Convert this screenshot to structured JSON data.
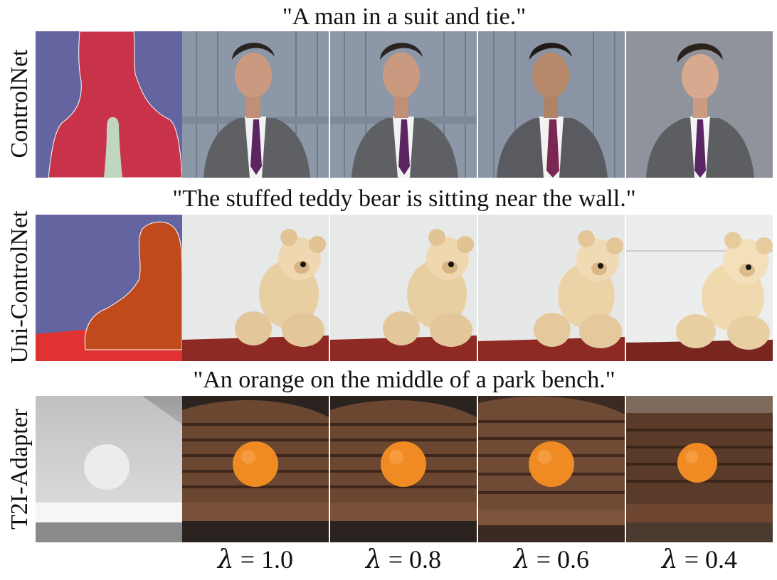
{
  "rows": [
    {
      "method": "ControlNet",
      "prompt": "\"A man in a suit and tie.\""
    },
    {
      "method": "Uni-ControlNet",
      "prompt": "\"The stuffed teddy bear is sitting near the wall.\""
    },
    {
      "method": "T2I-Adapter",
      "prompt": "\"An orange on the middle of a park bench.\""
    }
  ],
  "lambda_symbol": "λ",
  "lambda_values": [
    "= 1.0",
    "= 0.8",
    "= 0.6",
    "= 0.4"
  ],
  "colors": {
    "seg_background": "#6465a0",
    "seg_person": "#c8334a",
    "seg_tie": "#c0d6c0",
    "seg_bear": "#c04a1c",
    "seg_floor": "#e03232"
  }
}
